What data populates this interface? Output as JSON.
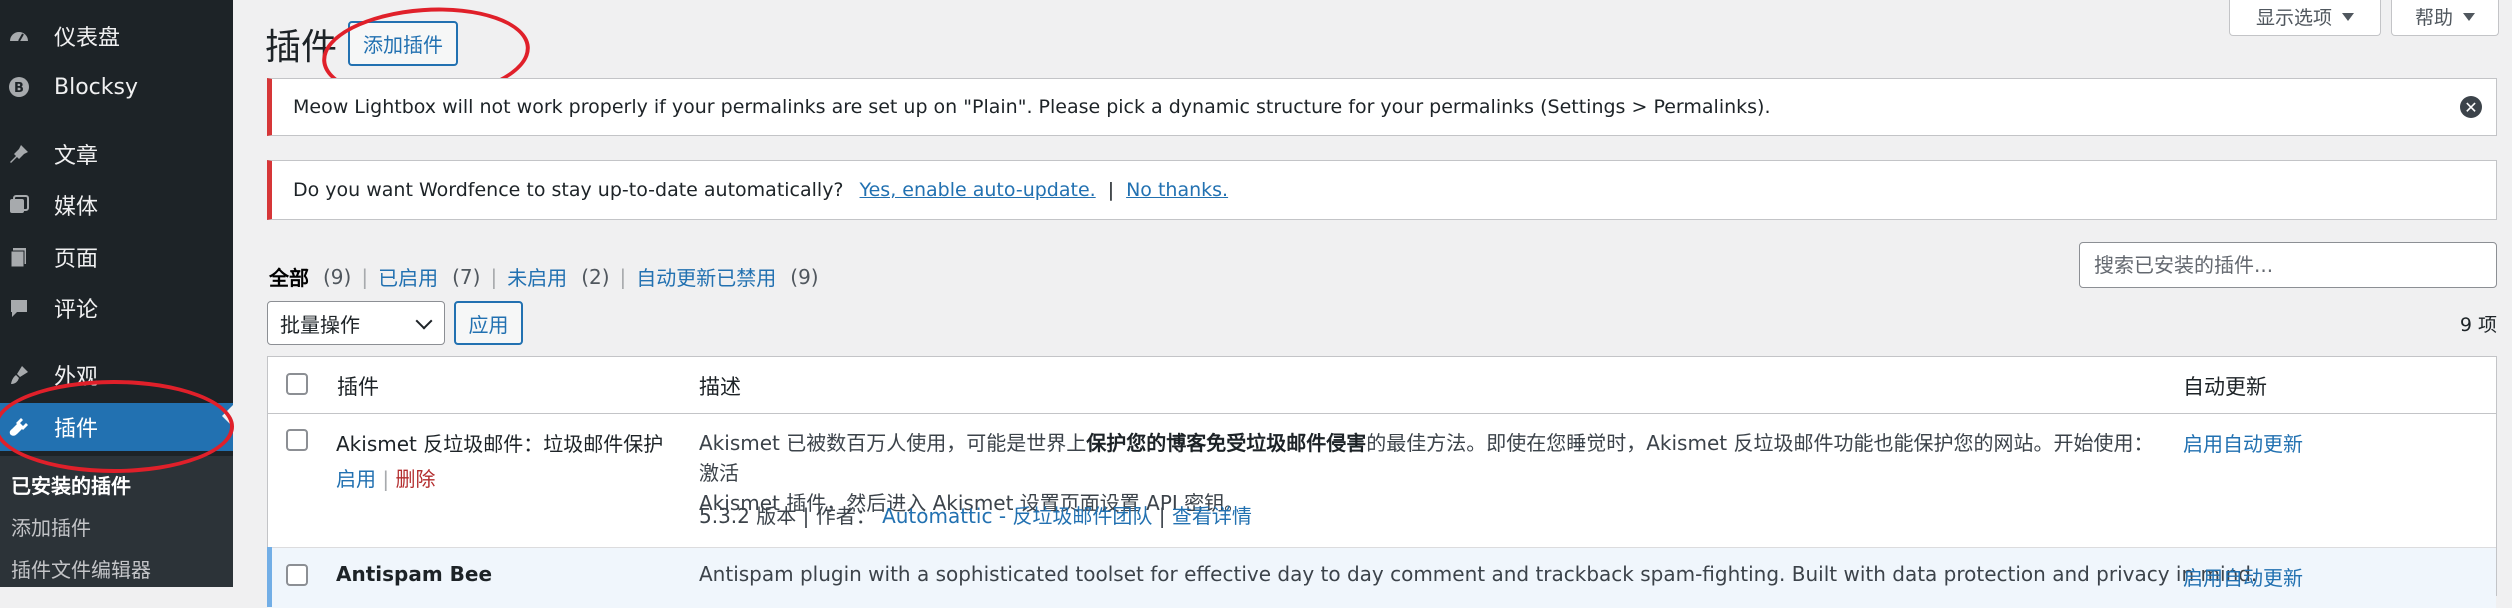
{
  "sidebar": {
    "items": [
      {
        "label": "仪表盘",
        "icon": "dashboard-icon"
      },
      {
        "label": "Blocksy",
        "icon": "blocksy-icon"
      },
      {
        "label": "文章",
        "icon": "pin-icon"
      },
      {
        "label": "媒体",
        "icon": "media-icon"
      },
      {
        "label": "页面",
        "icon": "page-icon"
      },
      {
        "label": "评论",
        "icon": "comment-icon"
      },
      {
        "label": "外观",
        "icon": "appearance-icon"
      },
      {
        "label": "插件",
        "icon": "plugin-icon"
      }
    ],
    "submenu": [
      "已安装的插件",
      "添加插件",
      "插件文件编辑器"
    ]
  },
  "header": {
    "title": "插件",
    "add_button": "添加插件",
    "screen_options": "显示选项",
    "help": "帮助"
  },
  "notices": {
    "meow": "Meow Lightbox will not work properly if your permalinks are set up on \"Plain\". Please pick a dynamic structure for your permalinks (Settings > Permalinks).",
    "wordfence_text": "Do you want Wordfence to stay up-to-date automatically?",
    "wordfence_yes": "Yes, enable auto-update.",
    "wordfence_sep": "|",
    "wordfence_no": "No thanks."
  },
  "filters": {
    "all": {
      "label": "全部",
      "count": "(9)"
    },
    "active": {
      "label": "已启用",
      "count": "(7)"
    },
    "inactive": {
      "label": "未启用",
      "count": "(2)"
    },
    "autoupdate_disabled": {
      "label": "自动更新已禁用",
      "count": "(9)"
    }
  },
  "search": {
    "placeholder": "搜索已安装的插件..."
  },
  "bulk": {
    "selected": "批量操作",
    "apply": "应用"
  },
  "count_text": "9 项",
  "table": {
    "headers": {
      "plugin": "插件",
      "description": "描述",
      "auto_update": "自动更新"
    },
    "rows": [
      {
        "name": "Akismet 反垃圾邮件：垃圾邮件保护",
        "action_activate": "启用",
        "action_delete": "删除",
        "desc_1": "Akismet 已被数百万人使用，可能是世界上",
        "desc_bold": "保护您的博客免受垃圾邮件侵害",
        "desc_2": "的最佳方法。即使在您睡觉时，Akismet 反垃圾邮件功能也能保护您的网站。开始使用：激活",
        "desc_3": "Akismet 插件，然后进入 Akismet 设置页面设置 API 密钥。",
        "meta_version": "5.3.2 版本 | 作者：",
        "meta_author": "Automattic - 反垃圾邮件团队",
        "meta_details": "查看详情",
        "auto_update": "启用自动更新"
      },
      {
        "name": "Antispam Bee",
        "desc_1": "Antispam plugin with a sophisticated toolset for effective day to day comment and trackback spam-fighting. Built with data protection and privacy in mind.",
        "auto_update": "启用自动更新"
      }
    ]
  }
}
